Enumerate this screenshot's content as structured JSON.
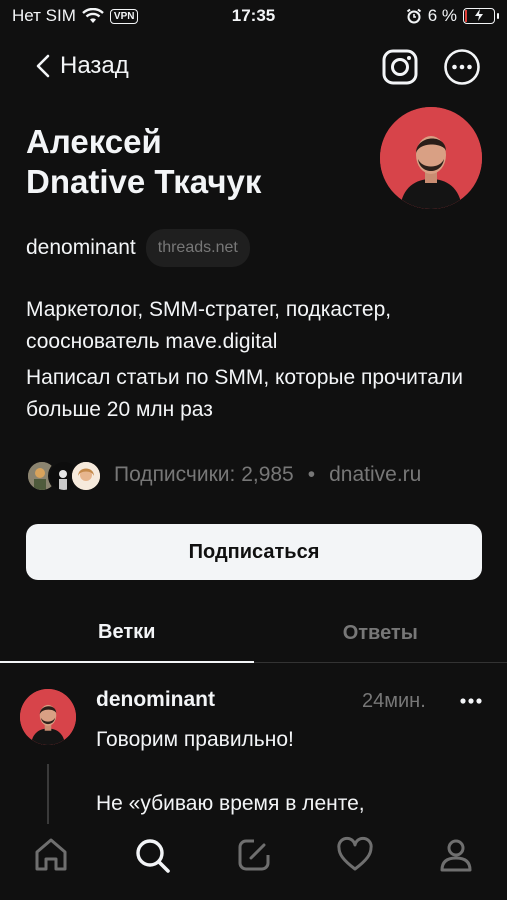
{
  "status_bar": {
    "carrier": "Нет SIM",
    "vpn": "VPN",
    "time": "17:35",
    "battery": "6 %",
    "battery_level": 0.06,
    "icons": [
      "wifi-icon",
      "alarm-icon",
      "battery-charging-icon"
    ]
  },
  "header": {
    "back_label": "Назад",
    "icons": [
      "chevron-left-icon",
      "instagram-icon",
      "more-icon"
    ]
  },
  "profile": {
    "name_line1": "Алексей",
    "name_line2": "Dnative Ткачук",
    "handle": "denominant",
    "domain_badge": "threads.net",
    "bio_line1": "Маркетолог, SMM-стратег, подкастер, сооснователь mave.digital",
    "bio_line2": "Написал статьи по SMM, которые прочитали больше 20 млн раз",
    "followers_label": "Подписчики: 2,985",
    "separator": "•",
    "link": "dnative.ru",
    "follow_button": "Подписаться"
  },
  "tabs": [
    {
      "label": "Ветки",
      "active": true
    },
    {
      "label": "Ответы",
      "active": false
    }
  ],
  "post": {
    "username": "denominant",
    "time": "24мин.",
    "text_line1": "Говорим правильно!",
    "text_line2": "Не «убиваю время в ленте,"
  },
  "bottom_nav": [
    "home-icon",
    "search-icon",
    "compose-icon",
    "heart-icon",
    "profile-icon"
  ],
  "colors": {
    "background": "#101010",
    "text": "#f3f5f7",
    "muted": "#777777",
    "avatar_bg": "#d7444a",
    "battery_low": "#e0413b"
  }
}
